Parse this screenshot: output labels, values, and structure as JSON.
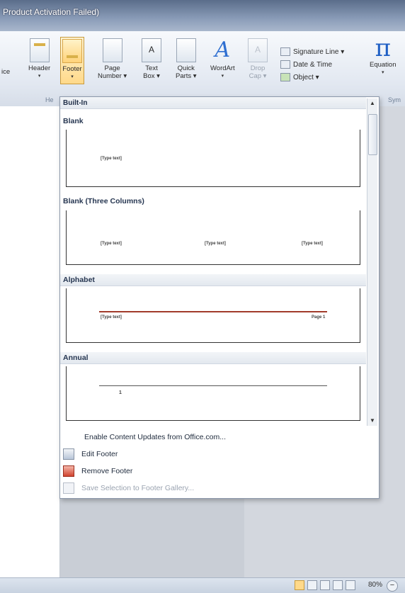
{
  "window": {
    "title": "Product Activation Failed)"
  },
  "ribbon": {
    "partial_left_label": "ice",
    "buttons": [
      {
        "label": "Header",
        "sub": "▾"
      },
      {
        "label": "Footer",
        "sub": "▾"
      },
      {
        "label": "Page",
        "sub": "Number ▾"
      },
      {
        "label": "Text",
        "sub": "Box ▾"
      },
      {
        "label": "Quick",
        "sub": "Parts ▾"
      },
      {
        "label": "WordArt",
        "sub": "▾"
      },
      {
        "label": "Drop",
        "sub": "Cap ▾"
      }
    ],
    "signature_line": "Signature Line ▾",
    "date_time": "Date & Time",
    "object": "Object ▾",
    "equation": "Equation",
    "equation_sub": "▾",
    "group_label_hf": "He",
    "group_label_sym": "Sym"
  },
  "gallery": {
    "builtin_label": "Built-In",
    "categories": [
      {
        "name": "Blank",
        "placeholders": [
          "[Type text]"
        ]
      },
      {
        "name": "Blank (Three Columns)",
        "placeholders": [
          "[Type text]",
          "[Type text]",
          "[Type text]"
        ]
      },
      {
        "name": "Alphabet",
        "placeholders": [
          "[Type text]",
          "Page 1"
        ]
      },
      {
        "name": "Annual",
        "placeholders": [
          "1"
        ]
      }
    ],
    "menu": [
      {
        "label": "Enable Content Updates from Office.com..."
      },
      {
        "label": "Edit Footer"
      },
      {
        "label": "Remove Footer"
      },
      {
        "label": "Save Selection to Footer Gallery..."
      }
    ]
  },
  "statusbar": {
    "zoom": "80%",
    "zoom_minus": "−"
  }
}
